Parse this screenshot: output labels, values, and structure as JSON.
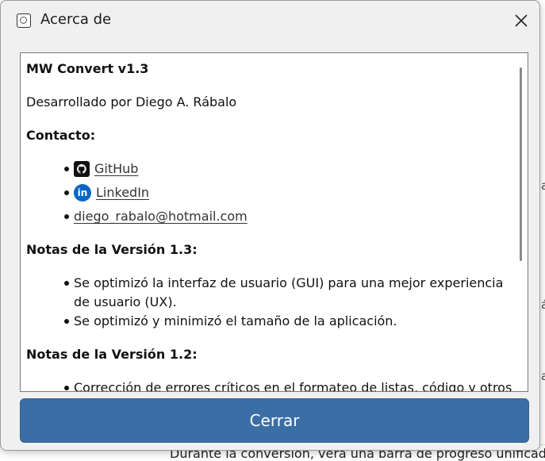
{
  "window": {
    "title": "Acerca de",
    "icon": "app-logo-icon"
  },
  "about": {
    "app_name": "MW Convert v1.3",
    "developer": "Desarrollado por Diego A. Rábalo",
    "contact_header": "Contacto:",
    "contacts": [
      {
        "icon": "github-icon",
        "label": "GitHub"
      },
      {
        "icon": "linkedin-icon",
        "label": "LinkedIn",
        "icon_text": "in"
      },
      {
        "label": "diego_rabalo@hotmail.com"
      }
    ],
    "notes_13_header": "Notas de la Versión 1.3:",
    "notes_13": [
      "Se optimizó la interfaz de usuario (GUI) para una mejor experiencia",
      "de usuario (UX).",
      "Se optimizó y minimizó el tamaño de la aplicación."
    ],
    "notes_12_header": "Notas de la Versión 1.2:",
    "notes_12": [
      "Corrección de errores críticos en el formateo de listas, código y otros"
    ]
  },
  "buttons": {
    "close": "Cerrar"
  },
  "background": {
    "bottom_text": "Durante la conversión, verá una barra de progreso unificada"
  },
  "colors": {
    "primary_button": "#3b6ea5",
    "link_blue": "#0a66c2"
  }
}
